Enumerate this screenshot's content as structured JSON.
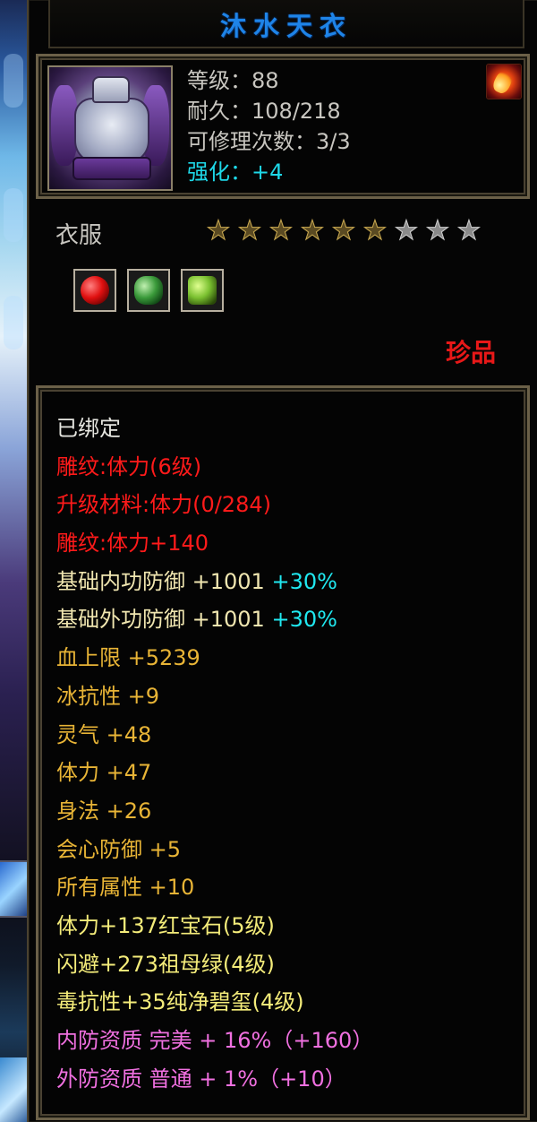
{
  "item": {
    "name": "沐水天衣",
    "level_line": "等级：88",
    "durability_line": "耐久：108/218",
    "repair_line": "可修理次数：3/3",
    "strength_line": "强化：+4",
    "type": "衣服",
    "stars_filled": 6,
    "stars_total": 9,
    "rarity": "珍品",
    "gems": [
      "ruby",
      "emerald",
      "jade"
    ],
    "icon": "purple-armor-robe-icon",
    "badge_icon": "fire-element-icon"
  },
  "attributes": {
    "bound": "已绑定",
    "engrave": "雕纹:体力(6级)",
    "upgrade_material": "升级材料:体力(0/284)",
    "engrave_bonus": "雕纹:体力+140",
    "base_inner_def": "基础内功防御  +1001",
    "base_inner_def_pct": "+30%",
    "base_outer_def": "基础外功防御  +1001",
    "base_outer_def_pct": "+30%",
    "hp_max": "血上限  +5239",
    "ice_res": "冰抗性  +9",
    "spirit": "灵气  +48",
    "stamina": "体力  +47",
    "agility": "身法  +26",
    "crit_def": "会心防御  +5",
    "all_attr": "所有属性  +10",
    "gem1": "体力+137红宝石(5级)",
    "gem2": "闪避+273祖母绿(4级)",
    "gem3": "毒抗性+35纯净碧玺(4级)",
    "inner_quality": "内防资质  完美  +  16%（+160）",
    "outer_quality": "外防资质  普通  +  1%（+10）"
  },
  "colors": {
    "title": "#1e84e8",
    "rarity": "#e81818",
    "strength": "#1ed8e8",
    "engrave": "#ff1a1a",
    "base_stat": "#f0e6b0",
    "bonus_stat": "#e8b436",
    "gem_stat": "#f4ec7a",
    "quality": "#f070e0",
    "percent": "#20e8f0"
  }
}
